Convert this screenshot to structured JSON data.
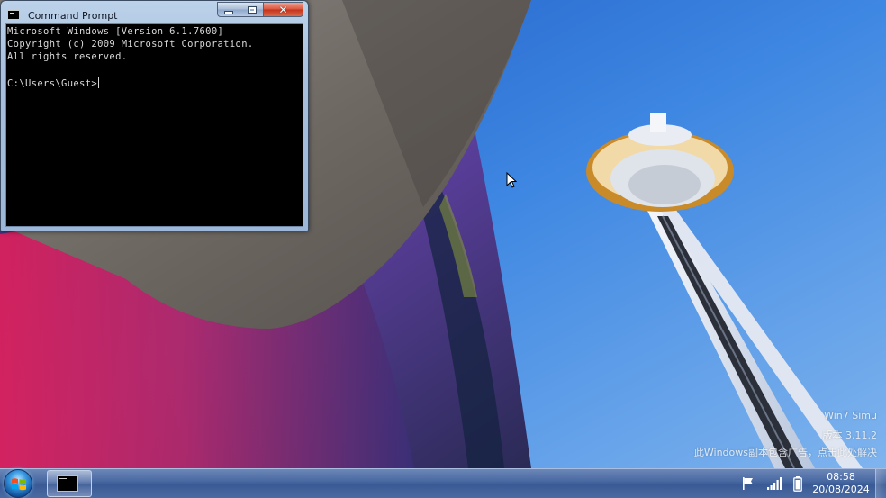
{
  "cmd": {
    "title": "Command Prompt",
    "lines": [
      "Microsoft Windows [Version 6.1.7600]",
      "Copyright (c) 2009 Microsoft Corporation.",
      "All rights reserved."
    ],
    "prompt": "C:\\Users\\Guest>"
  },
  "watermark": {
    "line1": "Win7 Simu",
    "line2": "版本 3.11.2",
    "line3": "此Windows副本包含广告，点击此处解决"
  },
  "taskbar": {
    "time": "08:58",
    "date": "20/08/2024"
  },
  "icons": {
    "start": "windows-logo-icon",
    "task_cmd": "command-prompt-icon",
    "flag": "action-center-flag-icon",
    "network": "signal-bars-icon",
    "battery": "battery-icon"
  }
}
